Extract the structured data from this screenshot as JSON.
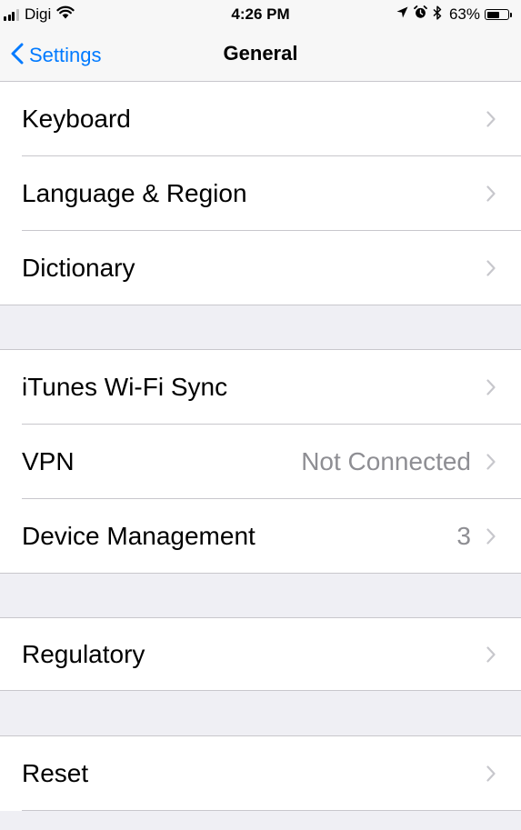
{
  "status_bar": {
    "carrier": "Digi",
    "time": "4:26 PM",
    "battery_percent": "63%",
    "battery_level": 0.63,
    "icons": [
      "signal-icon",
      "wifi-icon",
      "location-icon",
      "alarm-icon",
      "bluetooth-icon",
      "battery-icon"
    ]
  },
  "nav": {
    "back_label": "Settings",
    "title": "General"
  },
  "groups": [
    {
      "rows": [
        {
          "label": "Keyboard",
          "detail": ""
        },
        {
          "label": "Language & Region",
          "detail": ""
        },
        {
          "label": "Dictionary",
          "detail": ""
        }
      ]
    },
    {
      "rows": [
        {
          "label": "iTunes Wi-Fi Sync",
          "detail": ""
        },
        {
          "label": "VPN",
          "detail": "Not Connected"
        },
        {
          "label": "Device Management",
          "detail": "3"
        }
      ]
    },
    {
      "rows": [
        {
          "label": "Regulatory",
          "detail": ""
        }
      ]
    },
    {
      "rows": [
        {
          "label": "Reset",
          "detail": ""
        }
      ]
    }
  ],
  "colors": {
    "accent": "#007aff",
    "background": "#efeff4",
    "detail_text": "#8e8e93",
    "chevron": "#c7c7cc",
    "separator": "#c8c7cc"
  }
}
